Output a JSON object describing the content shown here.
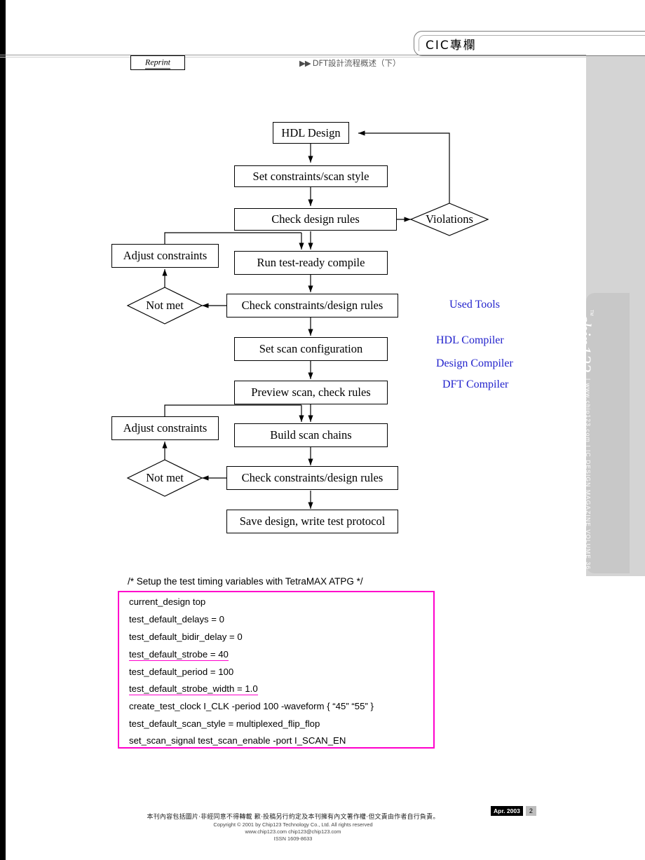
{
  "header": {
    "title": "CIC專欄",
    "reprint_label": "Reprint",
    "subtitle_arrows": "▶▶",
    "subtitle": "DFT設計流程概述（下）"
  },
  "flowchart": {
    "nodes": [
      {
        "id": "hdl-design",
        "label": "HDL Design"
      },
      {
        "id": "set-constraints",
        "label": "Set constraints/scan style"
      },
      {
        "id": "check-design-rules",
        "label": "Check design rules"
      },
      {
        "id": "violations",
        "label": "Violations"
      },
      {
        "id": "adjust-constraints-1",
        "label": "Adjust constraints"
      },
      {
        "id": "run-test-ready-compile",
        "label": "Run test-ready compile"
      },
      {
        "id": "not-met-1",
        "label": "Not met"
      },
      {
        "id": "check-constraints-1",
        "label": "Check constraints/design rules"
      },
      {
        "id": "set-scan-configuration",
        "label": "Set scan configuration"
      },
      {
        "id": "preview-scan",
        "label": "Preview scan, check rules"
      },
      {
        "id": "adjust-constraints-2",
        "label": "Adjust constraints"
      },
      {
        "id": "build-scan-chains",
        "label": "Build scan chains"
      },
      {
        "id": "not-met-2",
        "label": "Not met"
      },
      {
        "id": "check-constraints-2",
        "label": "Check constraints/design rules"
      },
      {
        "id": "save-design",
        "label": "Save design, write test protocol"
      }
    ]
  },
  "used_tools": {
    "heading": "Used Tools",
    "items": [
      "HDL Compiler",
      "Design Compiler",
      "DFT Compiler"
    ]
  },
  "code": {
    "comment": "/* Setup the test timing variables with TetraMAX ATPG */",
    "lines": [
      {
        "text": "current_design top",
        "highlight": false
      },
      {
        "text": "test_default_delays = 0",
        "highlight": false
      },
      {
        "text": "test_default_bidir_delay = 0",
        "highlight": false
      },
      {
        "text": "test_default_strobe = 40",
        "highlight": true
      },
      {
        "text": "test_default_period = 100",
        "highlight": false
      },
      {
        "text": "test_default_strobe_width = 1.0",
        "highlight": true
      },
      {
        "text": "create_test_clock I_CLK -period 100 -waveform {  “45”     “55”  }",
        "highlight": false
      },
      {
        "text": "test_default_scan_style = multiplexed_flip_flop",
        "highlight": false
      },
      {
        "text": "set_scan_signal test_scan_enable -port I_SCAN_EN",
        "highlight": false
      }
    ],
    "highlight_color": "#ff00cc"
  },
  "sidebar": {
    "logo": "chip123",
    "logo_tm": "TM",
    "vertical_text": "| www.chip123.com | IC DESIGN MAGAZINE VOLUME 36"
  },
  "footer": {
    "page_date": "Apr. 2003",
    "page_number": "2",
    "line_cn": "本刊內容包括圖片‧非經同意不得轉載 歉‧投稿另行約定及本刊擁有內文著作權‧但文責由作者自行負責。",
    "line_en1": "Copyright © 2001 by Chip123 Technology Co., Ltd. All rights reserved",
    "line_en2": "www.chip123.com  chip123@chip123.com",
    "line_en3": "ISSN 1609-8633"
  }
}
